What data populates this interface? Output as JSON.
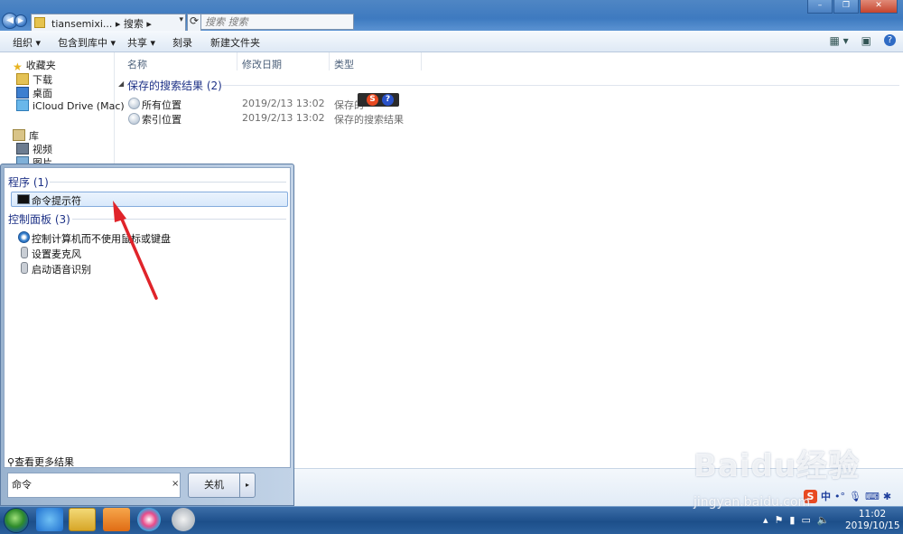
{
  "address": {
    "crumbs": "tiansemixi... ▸ 搜索 ▸",
    "search_placeholder": "搜索 搜索"
  },
  "toolbar": {
    "organize": "组织 ▾",
    "include_in_library": "包含到库中 ▾",
    "share": "共享 ▾",
    "burn": "刻录",
    "new_folder": "新建文件夹"
  },
  "nav": {
    "favorites": "收藏夹",
    "downloads": "下载",
    "desktop": "桌面",
    "icloud": "iCloud Drive (Mac)",
    "libraries": "库",
    "videos": "视频",
    "pictures": "图片"
  },
  "columns": {
    "name": "名称",
    "date": "修改日期",
    "type": "类型"
  },
  "group": {
    "header": "保存的搜索结果 (2)"
  },
  "files": [
    {
      "name": "所有位置",
      "date": "2019/2/13 13:02",
      "type": "保存的"
    },
    {
      "name": "索引位置",
      "date": "2019/2/13 13:02",
      "type": "保存的搜索结果"
    }
  ],
  "start_menu": {
    "programs_header": "程序 (1)",
    "programs": [
      "命令提示符"
    ],
    "control_panel_header": "控制面板 (3)",
    "control_panel": [
      "控制计算机而不使用鼠标或键盘",
      "设置麦克风",
      "启动语音识别"
    ],
    "more_results": "查看更多结果",
    "search_value": "命令",
    "search_clear": "×",
    "shutdown": "关机",
    "shutdown_arrow": "▸"
  },
  "ime": {
    "mode": "中"
  },
  "clock": {
    "time": "11:02",
    "date": "2019/10/15"
  },
  "watermark": {
    "brand": "Baidu经验",
    "url": "jingyan.baidu.com"
  },
  "colors": {
    "accent": "#1e3287",
    "arrow": "#e0242a"
  }
}
